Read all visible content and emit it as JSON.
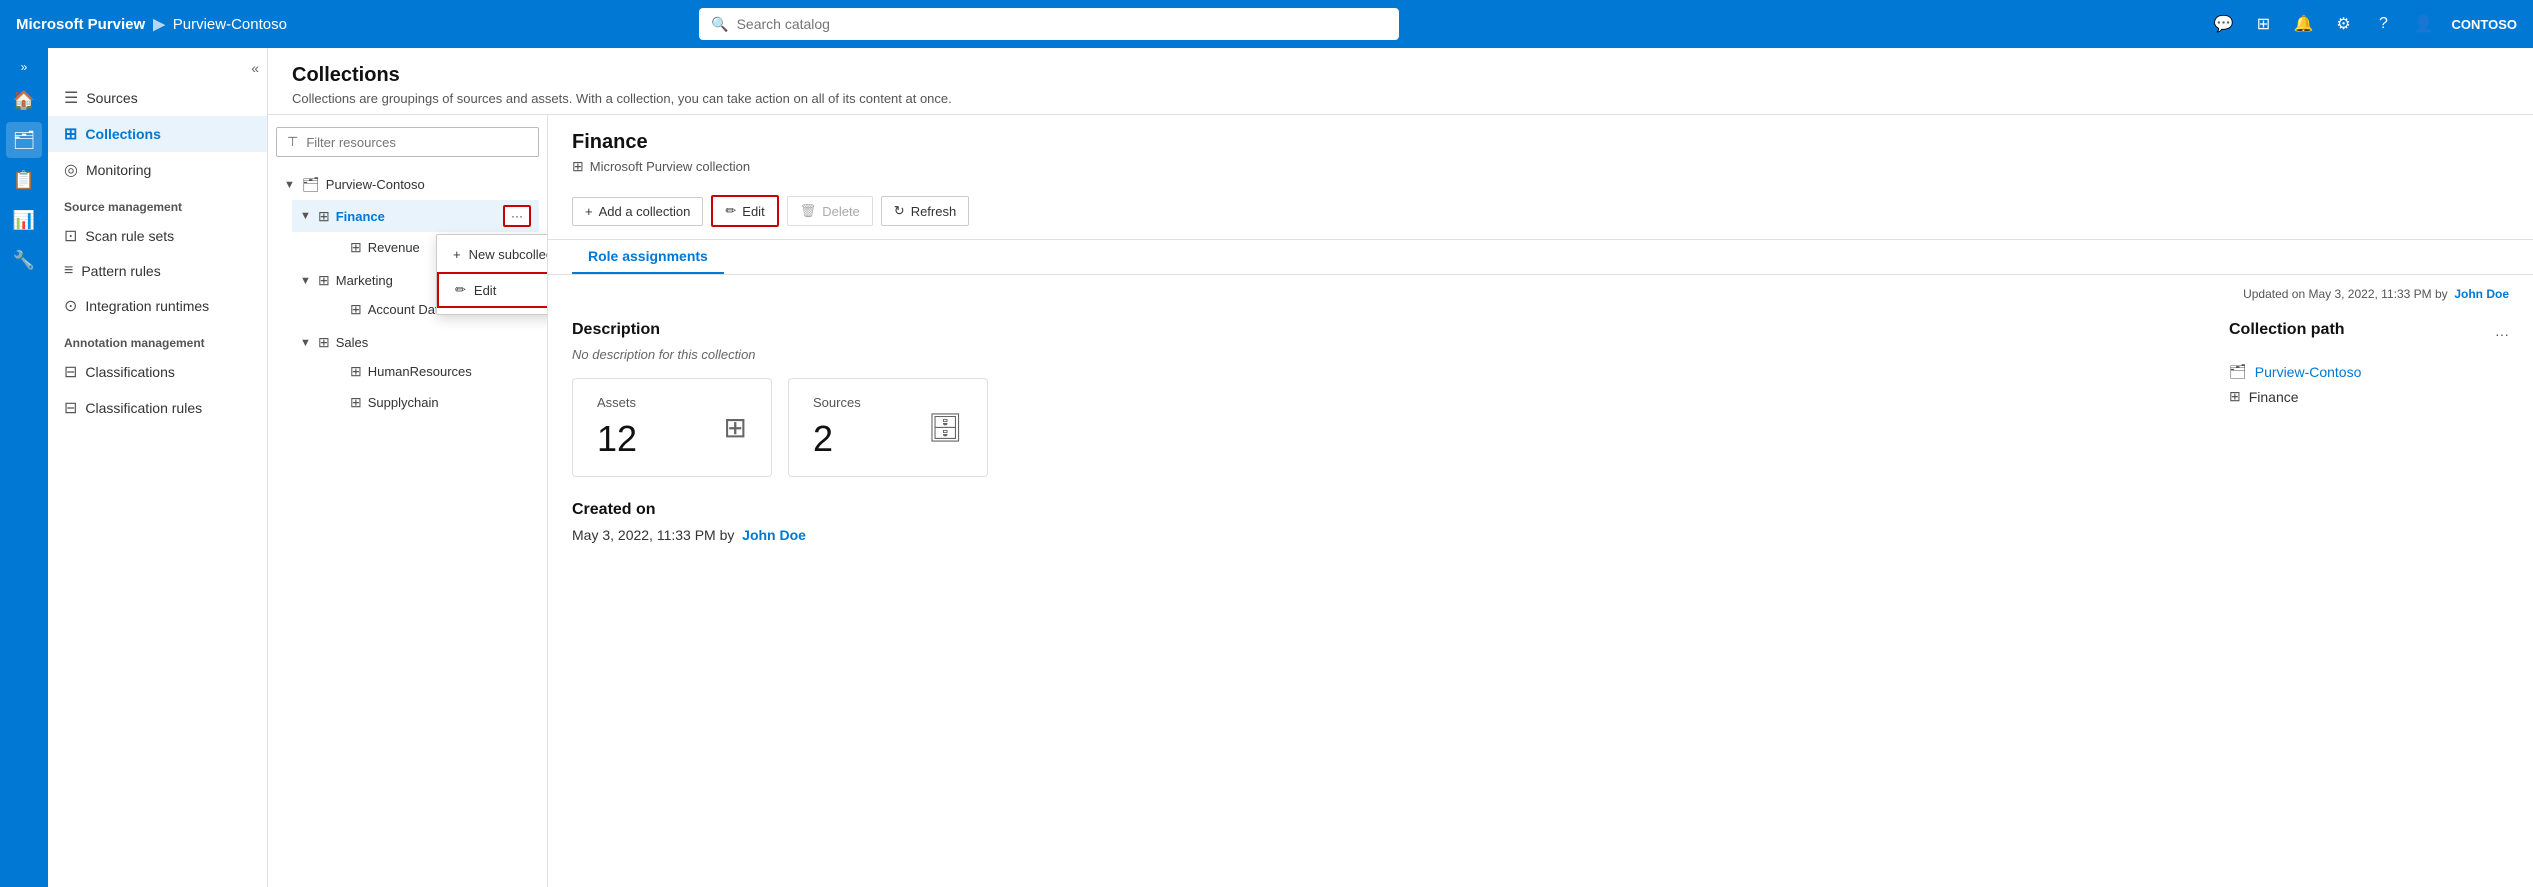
{
  "topbar": {
    "brand": "Microsoft Purview",
    "separator": "▶",
    "sub": "Purview-Contoso",
    "search_placeholder": "Search catalog",
    "user": "CONTOSO"
  },
  "sidebar": {
    "collapse_icon": "«",
    "expand_icon": "»",
    "items": [
      {
        "id": "sources",
        "label": "Sources",
        "icon": "☰"
      },
      {
        "id": "collections",
        "label": "Collections",
        "icon": "⊞"
      },
      {
        "id": "monitoring",
        "label": "Monitoring",
        "icon": "◎"
      }
    ],
    "section_source": "Source management",
    "source_items": [
      {
        "id": "scan-rule-sets",
        "label": "Scan rule sets",
        "icon": "⊡"
      },
      {
        "id": "pattern-rules",
        "label": "Pattern rules",
        "icon": "≡"
      },
      {
        "id": "integration-runtimes",
        "label": "Integration runtimes",
        "icon": "⊙"
      }
    ],
    "section_annotation": "Annotation management",
    "annotation_items": [
      {
        "id": "classifications",
        "label": "Classifications",
        "icon": "⊟"
      },
      {
        "id": "classification-rules",
        "label": "Classification rules",
        "icon": "⊟"
      }
    ]
  },
  "collections": {
    "title": "Collections",
    "description": "Collections are groupings of sources and assets. With a collection, you can take action on all of its content at once.",
    "filter_placeholder": "Filter resources",
    "tree": {
      "root": "Purview-Contoso",
      "nodes": [
        {
          "id": "finance",
          "label": "Finance",
          "level": 1,
          "expanded": true,
          "selected": true
        },
        {
          "id": "revenue",
          "label": "Revenue",
          "level": 2
        },
        {
          "id": "marketing",
          "label": "Marketing",
          "level": 1,
          "expanded": true
        },
        {
          "id": "account-data",
          "label": "Account Data",
          "level": 2
        },
        {
          "id": "sales",
          "label": "Sales",
          "level": 1,
          "expanded": true
        },
        {
          "id": "human-resources",
          "label": "HumanResources",
          "level": 2
        },
        {
          "id": "supplychain",
          "label": "Supplychain",
          "level": 2
        }
      ]
    },
    "dropdown": {
      "items": [
        {
          "id": "new-subcollection",
          "label": "New subcollection",
          "icon": "+"
        },
        {
          "id": "edit",
          "label": "Edit",
          "icon": "✏"
        }
      ]
    }
  },
  "detail": {
    "title": "Finance",
    "subtitle": "Microsoft Purview collection",
    "toolbar": {
      "add_label": "Add a collection",
      "edit_label": "Edit",
      "delete_label": "Delete",
      "refresh_label": "Refresh"
    },
    "tab": "Role assignments",
    "updated": "Updated on May 3, 2022, 11:33 PM by",
    "updated_user": "John Doe",
    "description_title": "Description",
    "description_text": "No description for this collection",
    "assets_label": "Assets",
    "assets_count": "12",
    "sources_label": "Sources",
    "sources_count": "2",
    "created_title": "Created on",
    "created_text": "May 3, 2022, 11:33 PM by",
    "created_user": "John Doe",
    "path_title": "Collection path",
    "path_items": [
      {
        "id": "purview-contoso",
        "label": "Purview-Contoso",
        "clickable": true
      },
      {
        "id": "finance",
        "label": "Finance",
        "clickable": false
      }
    ]
  }
}
